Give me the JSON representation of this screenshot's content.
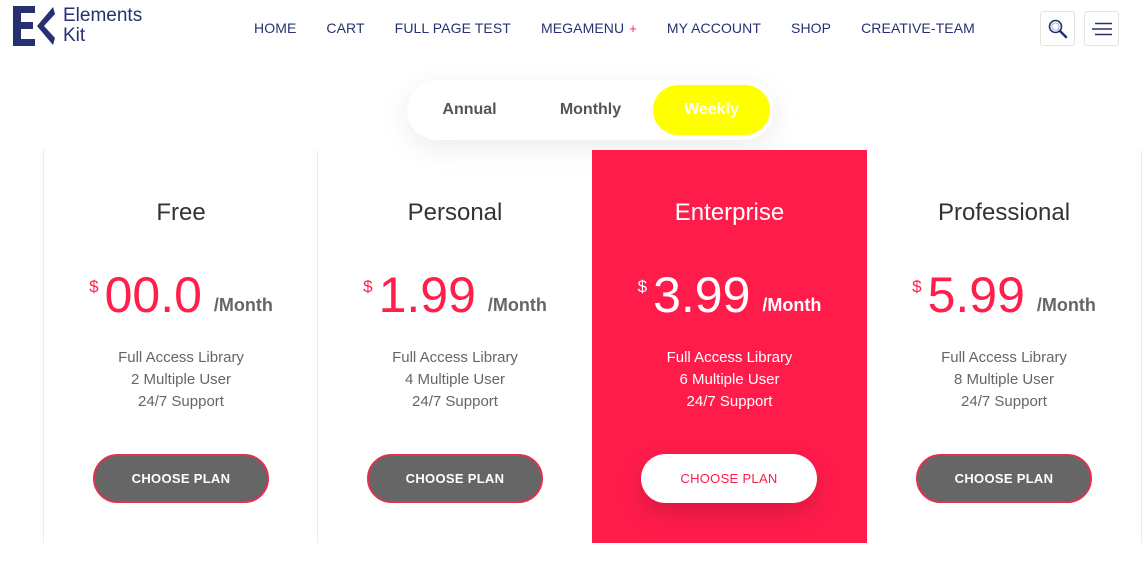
{
  "brand": {
    "line1": "Elements",
    "line2": "Kit",
    "color": "#273171"
  },
  "nav": {
    "items": [
      {
        "label": "HOME"
      },
      {
        "label": "CART"
      },
      {
        "label": "FULL PAGE TEST"
      },
      {
        "label": "MEGAMENU",
        "suffix": "+"
      },
      {
        "label": "MY ACCOUNT"
      },
      {
        "label": "SHOP"
      },
      {
        "label": "CREATIVE-TEAM"
      }
    ],
    "search_icon": "search-icon",
    "menu_icon": "hamburger-menu-icon"
  },
  "tabs": {
    "items": [
      "Annual",
      "Monthly",
      "Weekly"
    ],
    "active": "Weekly",
    "active_color": "#ffff00"
  },
  "plans": [
    {
      "name": "Free",
      "currency": "$",
      "amount": "00.0",
      "period": "/Month",
      "features": [
        "Full Access Library",
        "2 Multiple User",
        "24/7 Support"
      ],
      "button": "CHOOSE PLAN",
      "featured": false
    },
    {
      "name": "Personal",
      "currency": "$",
      "amount": "1.99",
      "period": "/Month",
      "features": [
        "Full Access Library",
        "4 Multiple User",
        "24/7 Support"
      ],
      "button": "CHOOSE PLAN",
      "featured": false
    },
    {
      "name": "Enterprise",
      "currency": "$",
      "amount": "3.99",
      "period": "/Month",
      "features": [
        "Full Access Library",
        "6 Multiple User",
        "24/7 Support"
      ],
      "button": "CHOOSE PLAN",
      "featured": true
    },
    {
      "name": "Professional",
      "currency": "$",
      "amount": "5.99",
      "period": "/Month",
      "features": [
        "Full Access Library",
        "8 Multiple User",
        "24/7 Support"
      ],
      "button": "CHOOSE PLAN",
      "featured": false
    }
  ],
  "colors": {
    "accent": "#ff1c4b",
    "button_dark": "#666666"
  }
}
